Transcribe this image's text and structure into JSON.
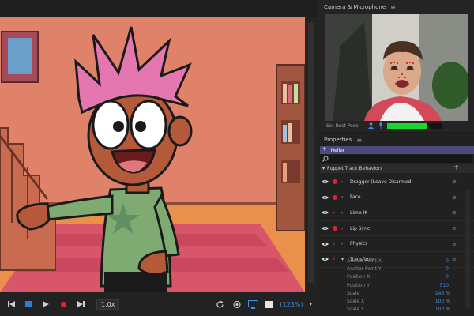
{
  "camera_panel": {
    "title": "Camera & Microphone",
    "set_rest_pose": "Set Rest Pose",
    "audio_level": 0.72
  },
  "transport": {
    "playback_rate": "1.0x",
    "zoom": "(123%)",
    "icons": [
      "go-to-start-icon",
      "stop-icon",
      "play-icon",
      "record-icon",
      "rate-dropdown",
      "refresh-icon",
      "camera-icon",
      "display-icon",
      "color-swatch",
      "zoom-dropdown"
    ]
  },
  "properties": {
    "title": "Properties",
    "puppet_name": "Heller",
    "behaviors_header": "Puppet Track Behaviors",
    "behaviors": [
      {
        "label": "Dragger (Leave Disarmed)",
        "armed": true,
        "expanded": false
      },
      {
        "label": "Face",
        "armed": true,
        "expanded": false
      },
      {
        "label": "Limb IK",
        "armed": false,
        "expanded": false
      },
      {
        "label": "Lip Sync",
        "armed": true,
        "expanded": false
      },
      {
        "label": "Physics",
        "armed": false,
        "expanded": false
      },
      {
        "label": "Transform",
        "armed": false,
        "expanded": true
      }
    ],
    "transform_params": [
      {
        "label": "Anchor Point X",
        "value": "0",
        "unit": ""
      },
      {
        "label": "Anchor Point Y",
        "value": "0",
        "unit": ""
      },
      {
        "label": "Position X",
        "value": "0",
        "unit": ""
      },
      {
        "label": "Position Y",
        "value": "510",
        "unit": ""
      },
      {
        "label": "Scale",
        "value": "145",
        "unit": "%"
      },
      {
        "label": "Scale X",
        "value": "100",
        "unit": "%"
      },
      {
        "label": "Scale Y",
        "value": "100",
        "unit": "%"
      }
    ]
  },
  "colors": {
    "accent": "#3b8fe6",
    "record": "#e0242b",
    "puppet_bar": "#4a4a7c",
    "audio_level": "#19d629"
  }
}
